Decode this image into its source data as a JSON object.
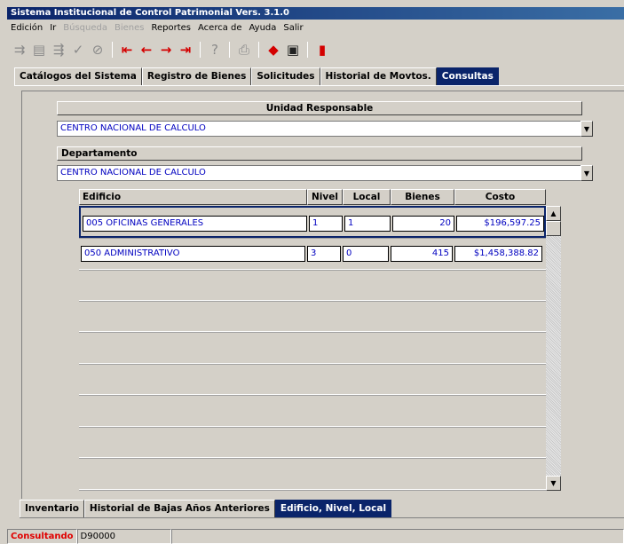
{
  "window": {
    "title": "Sistema Institucional de Control Patrimonial Vers. 3.1.0"
  },
  "menu": {
    "items": [
      {
        "label": "Edición",
        "enabled": true
      },
      {
        "label": "Ir",
        "enabled": true
      },
      {
        "label": "Búsqueda",
        "enabled": false
      },
      {
        "label": "Bienes",
        "enabled": false
      },
      {
        "label": "Reportes",
        "enabled": true
      },
      {
        "label": "Acerca de",
        "enabled": true
      },
      {
        "label": "Ayuda",
        "enabled": true
      },
      {
        "label": "Salir",
        "enabled": true
      }
    ]
  },
  "toolbar": {
    "icons": [
      "insert-record-icon",
      "duplicate-record-icon",
      "delete-record-icon",
      "accept-icon",
      "cancel-icon",
      "first-record-icon",
      "previous-record-icon",
      "next-record-icon",
      "last-record-icon",
      "help-icon",
      "print-icon",
      "erase-icon",
      "save-icon",
      "exit-icon"
    ]
  },
  "main_tabs": [
    {
      "label": "Catálogos del Sistema",
      "active": false
    },
    {
      "label": "Registro de Bienes",
      "active": false
    },
    {
      "label": "Solicitudes",
      "active": false
    },
    {
      "label": "Historial de Movtos.",
      "active": false
    },
    {
      "label": "Consultas",
      "active": true
    }
  ],
  "unidad": {
    "header": "Unidad Responsable",
    "value": "CENTRO NACIONAL DE CALCULO"
  },
  "departamento": {
    "header": "Departamento",
    "value": "CENTRO NACIONAL DE CALCULO"
  },
  "table": {
    "columns": [
      "Edificio",
      "Nivel",
      "Local",
      "Bienes",
      "Costo"
    ],
    "rows": [
      {
        "edificio": "005  OFICINAS GENERALES",
        "nivel": "1",
        "local": "1",
        "bienes": "20",
        "costo": "$196,597.25"
      },
      {
        "edificio": "050  ADMINISTRATIVO",
        "nivel": "3",
        "local": "0",
        "bienes": "415",
        "costo": "$1,458,388.82"
      }
    ]
  },
  "bottom_tabs": [
    {
      "label": "Inventario",
      "active": false
    },
    {
      "label": "Historial de Bajas Años Anteriores",
      "active": false
    },
    {
      "label": "Edificio, Nivel, Local",
      "active": true
    }
  ],
  "status": {
    "mode": "Consultando",
    "code": "D90000"
  },
  "colors": {
    "title_bar": "#0a246a",
    "active_tab": "#0a246a",
    "field_text": "#0000c0",
    "status_mode": "#e00000",
    "window_bg": "#d4d0c8"
  }
}
